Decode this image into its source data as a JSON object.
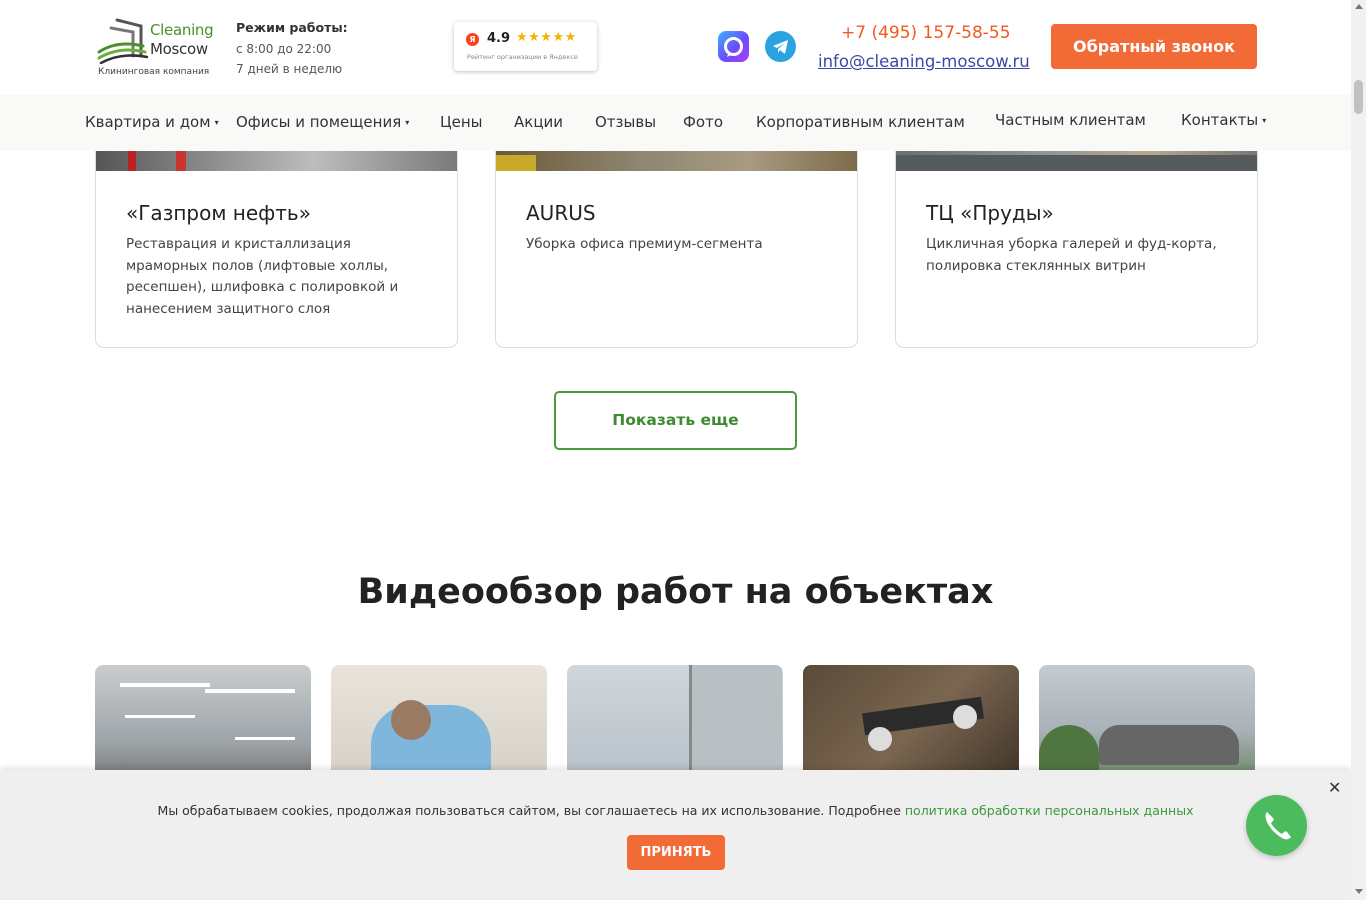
{
  "header": {
    "logo": {
      "line1": "Cleaning",
      "line2": "Moscow",
      "caption": "Клининговая компания"
    },
    "hours": {
      "title": "Режим работы:",
      "line1": "с 8:00 до 22:00",
      "line2": "7 дней в неделю"
    },
    "rating": {
      "badge": "Я",
      "value": "4.9",
      "stars": "★★★★★",
      "caption": "Рейтинг организации в Яндексе"
    },
    "phone": "+7 (495) 157-58-55",
    "email": "info@cleaning-moscow.ru",
    "callback_label": "Обратный звонок",
    "social": [
      "max-icon",
      "telegram-icon"
    ]
  },
  "nav": {
    "items": [
      {
        "label": "Квартира и дом",
        "dropdown": true
      },
      {
        "label": "Офисы и помещения",
        "dropdown": true
      },
      {
        "label": "Цены"
      },
      {
        "label": "Акции"
      },
      {
        "label": "Отзывы"
      },
      {
        "label": "Фото"
      },
      {
        "label": "Корпоративным клиентам"
      },
      {
        "label": "Частным клиентам"
      },
      {
        "label": "Контакты",
        "dropdown": true
      }
    ],
    "caret": "▾"
  },
  "cards": [
    {
      "title": "«Газпром нефть»",
      "text": "Реставрация и кристаллизация мраморных полов (лифтовые холлы, ресепшен), шлифовка с полировкой и нанесением защитного слоя"
    },
    {
      "title": "AURUS",
      "text": "Уборка офиса премиум-сегмента"
    },
    {
      "title": "ТЦ «Пруды»",
      "text": "Цикличная уборка галерей и фуд-корта, полировка стеклянных витрин"
    }
  ],
  "more_label": "Показать еще",
  "video_section": {
    "title": "Видеообзор работ на объектах"
  },
  "cookie": {
    "text": "Мы обрабатываем cookies, продолжая пользоваться сайтом, вы соглашаетесь на их использование. Подробнее",
    "link": "политика обработки персональных данных",
    "accept_label": "ПРИНЯТЬ",
    "close": "✕"
  },
  "colors": {
    "accent_orange": "#f26a35",
    "accent_green": "#4a9a3a",
    "link_blue": "#3b4aa8",
    "call_green": "#4bbb5e"
  }
}
